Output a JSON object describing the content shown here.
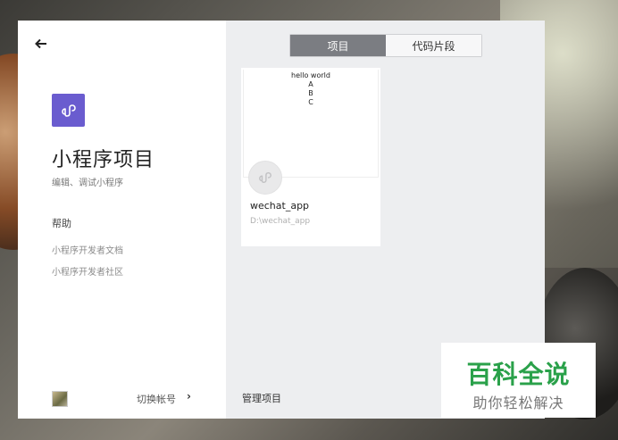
{
  "sidebar": {
    "title": "小程序项目",
    "subtitle": "编辑、调试小程序",
    "help_title": "帮助",
    "help_links": [
      "小程序开发者文档",
      "小程序开发者社区"
    ],
    "switch_account_label": "切换帐号"
  },
  "main": {
    "tabs": [
      {
        "label": "项目",
        "active": true
      },
      {
        "label": "代码片段",
        "active": false
      }
    ],
    "project_card": {
      "preview_lines": [
        "hello world",
        "A",
        "B",
        "C"
      ],
      "name": "wechat_app",
      "path": "D:\\wechat_app"
    },
    "manage_label": "管理项目"
  },
  "watermark": {
    "title": "百科全说",
    "subtitle": "助你轻松解决"
  },
  "colors": {
    "logo_purple": "#6a5ccf",
    "active_tab": "#7b7d82",
    "watermark_green": "#2aa14a"
  },
  "icons": {
    "back": "arrow-left-icon",
    "logo": "mini-program-link-icon",
    "switch": "chevron-right-icon"
  }
}
